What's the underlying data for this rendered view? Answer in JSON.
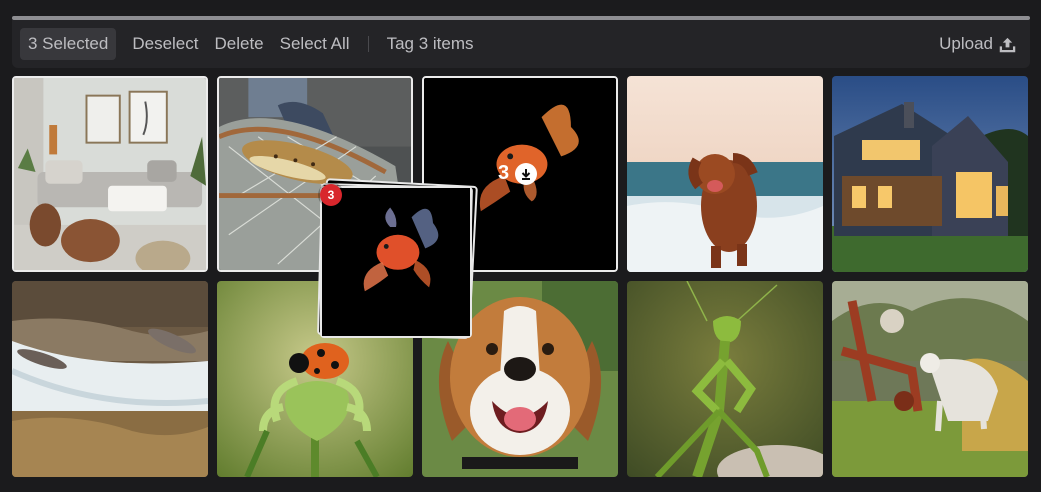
{
  "toolbar": {
    "selected_label": "3 Selected",
    "deselect_label": "Deselect",
    "delete_label": "Delete",
    "select_all_label": "Select All",
    "tag_label": "Tag 3 items",
    "upload_label": "Upload",
    "upload_icon": "upload-icon"
  },
  "gallery": {
    "tiles": [
      {
        "subject": "living-room-image",
        "selected": true
      },
      {
        "subject": "trout-in-net-image",
        "selected": true
      },
      {
        "subject": "goldfish-image",
        "selected": true
      },
      {
        "subject": "dog-running-beach-image",
        "selected": false
      },
      {
        "subject": "house-at-dusk-image",
        "selected": false
      },
      {
        "subject": "salmon-waterfall-image",
        "selected": false
      },
      {
        "subject": "ladybug-flower-image",
        "selected": false
      },
      {
        "subject": "beagle-portrait-image",
        "selected": false
      },
      {
        "subject": "praying-mantis-image",
        "selected": false
      },
      {
        "subject": "cat-and-dog-farm-image",
        "selected": false
      }
    ]
  },
  "drag": {
    "count_badge": "3",
    "drop_count": "3",
    "drop_icon": "download-icon",
    "badge_color": "#d8262c"
  },
  "colors": {
    "background": "#1b1b1d",
    "toolbar": "#242427",
    "selection_border": "#ececec"
  }
}
